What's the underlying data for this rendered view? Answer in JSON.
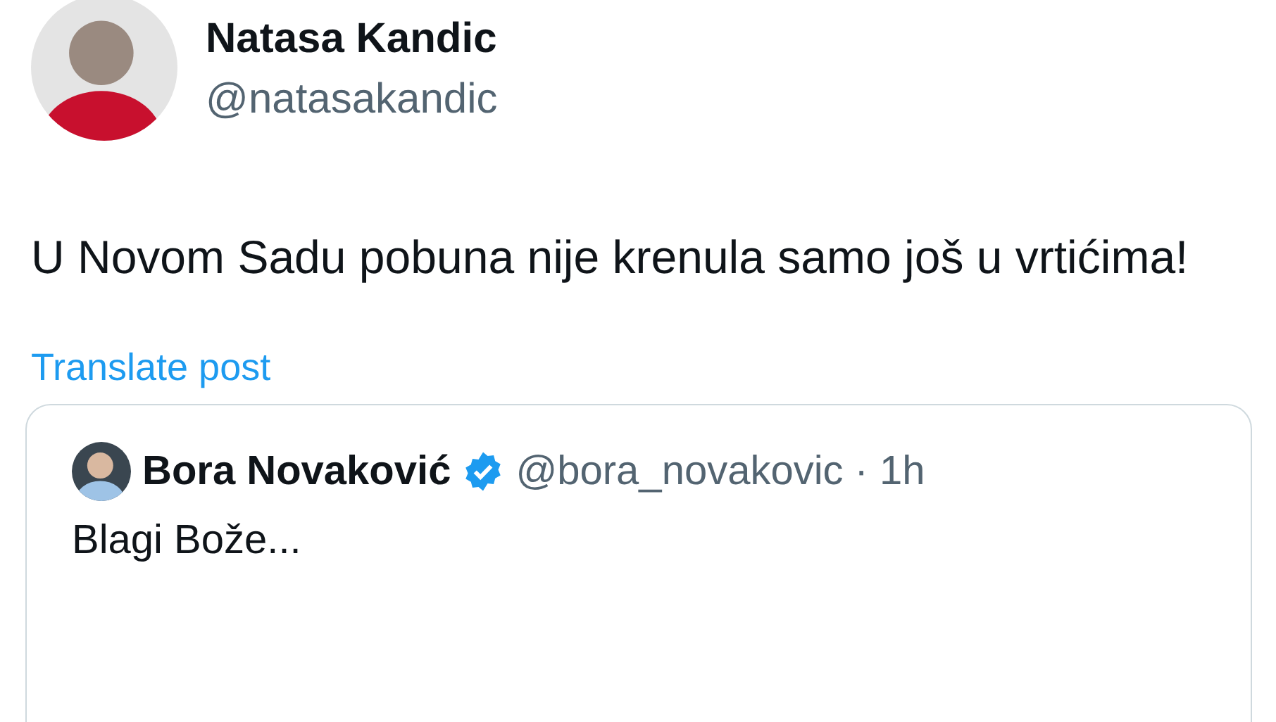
{
  "author": {
    "name": "Natasa Kandic",
    "handle": "@natasakandic"
  },
  "text": "U Novom Sadu pobuna nije krenula samo još u vrtićima!",
  "translate_link": "Translate post",
  "quote": {
    "name": "Bora Novaković",
    "verified": true,
    "handle": "@bora_novakovic",
    "separator": "·",
    "time": "1h",
    "text": "Blagi Bože..."
  }
}
